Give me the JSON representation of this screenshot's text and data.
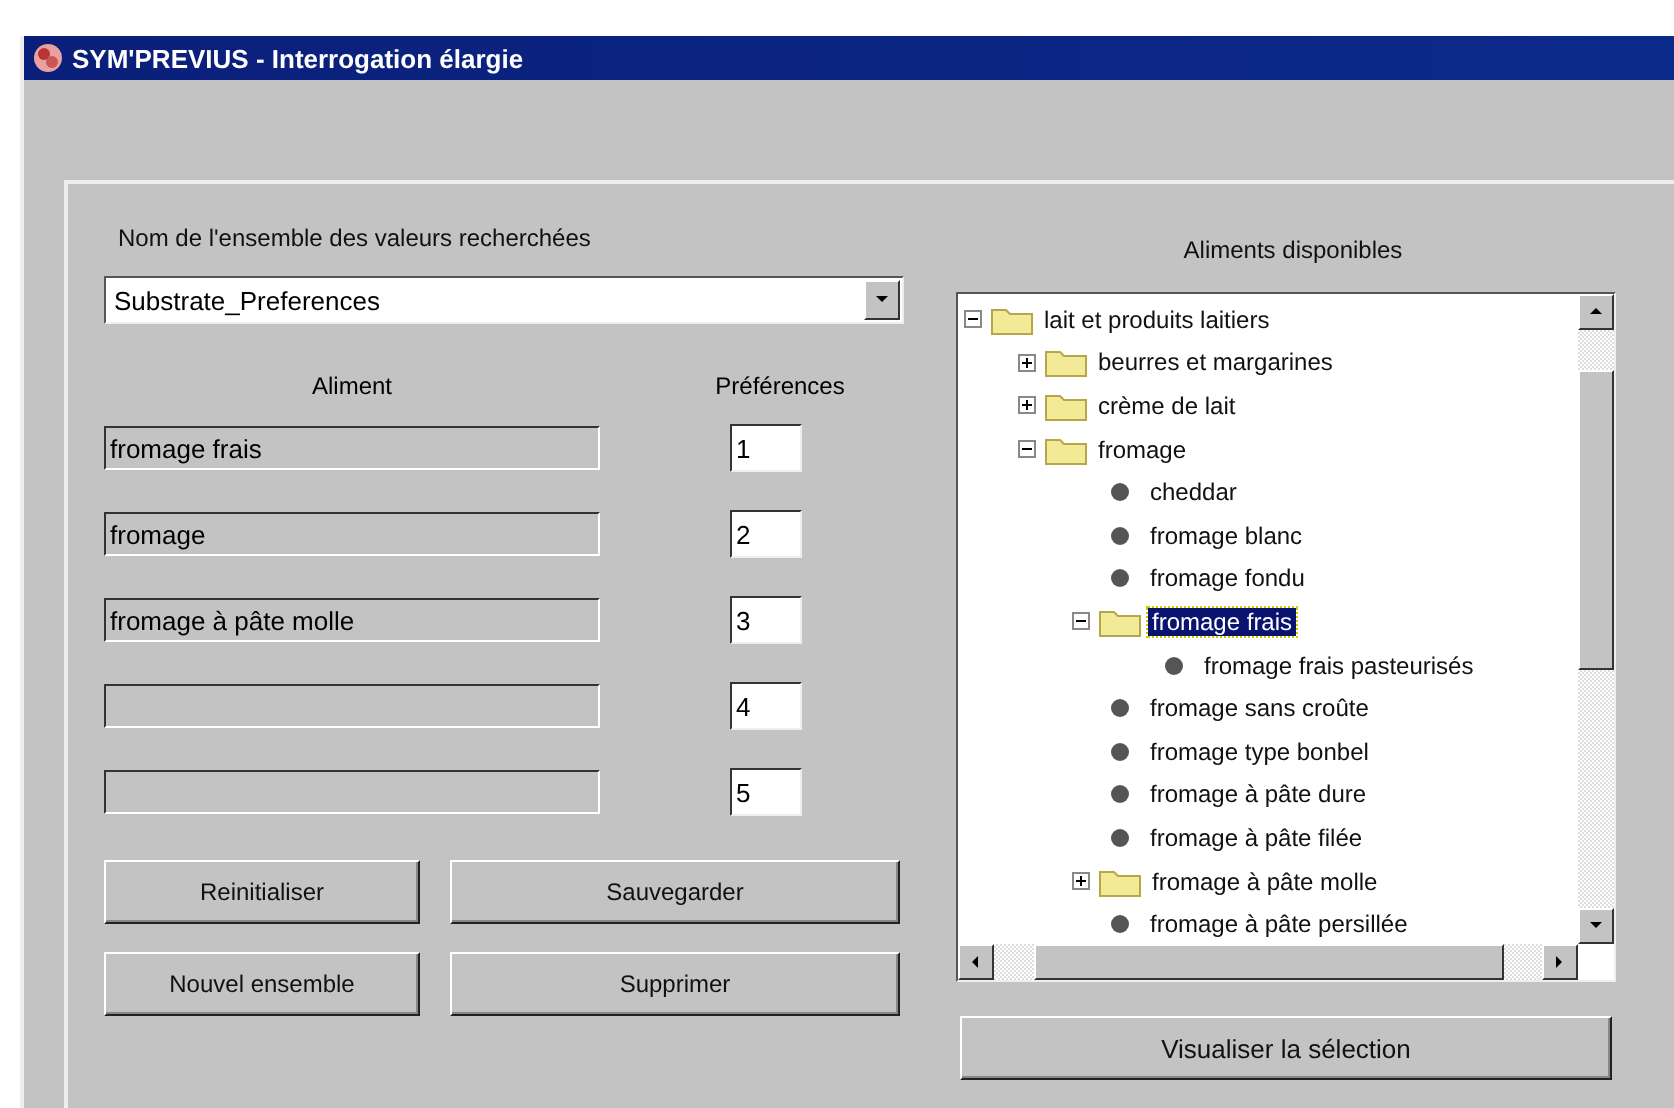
{
  "window": {
    "title": "SYM'PREVIUS - Interrogation élargie"
  },
  "set_name": {
    "label": "Nom de l'ensemble des valeurs recherchées",
    "value": "Substrate_Preferences"
  },
  "columns": [
    "Aliment",
    "Préférences"
  ],
  "rows": [
    {
      "aliment": "fromage frais",
      "preference": "1"
    },
    {
      "aliment": "fromage",
      "preference": "2"
    },
    {
      "aliment": "fromage à pâte molle",
      "preference": "3"
    },
    {
      "preference": "4"
    },
    {
      "preference": "5"
    }
  ],
  "buttons": [
    [
      "Reinitialiser",
      "Sauvegarder"
    ],
    [
      "Nouvel ensemble",
      "Supprimer"
    ]
  ],
  "tree": {
    "title": "Aliments disponibles",
    "items": [
      {
        "label": "lait et produits laitiers",
        "kind": "folder",
        "expanded": true,
        "selected": false,
        "children": [
          {
            "label": "beurres et margarines",
            "kind": "folder",
            "expanded": false,
            "selected": false
          },
          {
            "label": "crème de lait",
            "kind": "folder",
            "expanded": false,
            "selected": false
          },
          {
            "label": "fromage",
            "kind": "folder",
            "expanded": true,
            "selected": false,
            "children": [
              {
                "label": "cheddar",
                "kind": "leaf",
                "selected": false
              },
              {
                "label": "fromage blanc",
                "kind": "leaf",
                "selected": false
              },
              {
                "label": "fromage fondu",
                "kind": "leaf",
                "selected": false
              },
              {
                "label": "fromage frais",
                "kind": "folder",
                "expanded": true,
                "selected": true,
                "children": [
                  {
                    "label": "fromage frais pasteurisés",
                    "kind": "leaf",
                    "selected": false
                  }
                ]
              },
              {
                "label": "fromage sans croûte",
                "kind": "leaf",
                "selected": false
              },
              {
                "label": "fromage type bonbel",
                "kind": "leaf",
                "selected": false
              },
              {
                "label": "fromage à pâte dure",
                "kind": "leaf",
                "selected": false
              },
              {
                "label": "fromage à pâte filée",
                "kind": "leaf",
                "selected": false
              },
              {
                "label": "fromage à pâte molle",
                "kind": "folder",
                "expanded": false,
                "selected": false
              },
              {
                "label": "fromage à pâte persillée",
                "kind": "leaf",
                "selected": false
              }
            ]
          }
        ]
      }
    ]
  },
  "view_button": "Visualiser la sélection"
}
